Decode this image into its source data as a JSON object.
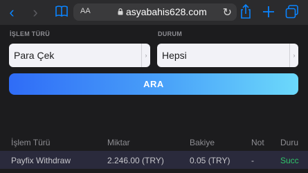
{
  "browser": {
    "text_size_label": "AA",
    "url": "asyabahis628.com",
    "accent_color": "#0a84ff"
  },
  "filters": {
    "transaction_type_label": "İŞLEM TÜRÜ",
    "transaction_type_value": "Para Çek",
    "status_label": "DURUM",
    "status_value": "Hepsi",
    "search_label": "ARA"
  },
  "table": {
    "headers": [
      "İşlem Türü",
      "Miktar",
      "Bakiye",
      "Not",
      "Duru"
    ],
    "rows": [
      {
        "type": "Payfix Withdraw",
        "amount": "2.246.00 (TRY)",
        "balance": "0.05 (TRY)",
        "note": "-",
        "status": "Succ"
      }
    ],
    "status_color": "#30c46a"
  },
  "icons": [
    "back-icon",
    "forward-icon",
    "book-icon",
    "lock-icon",
    "reload-icon",
    "share-icon",
    "new-tab-icon",
    "tabs-icon"
  ]
}
